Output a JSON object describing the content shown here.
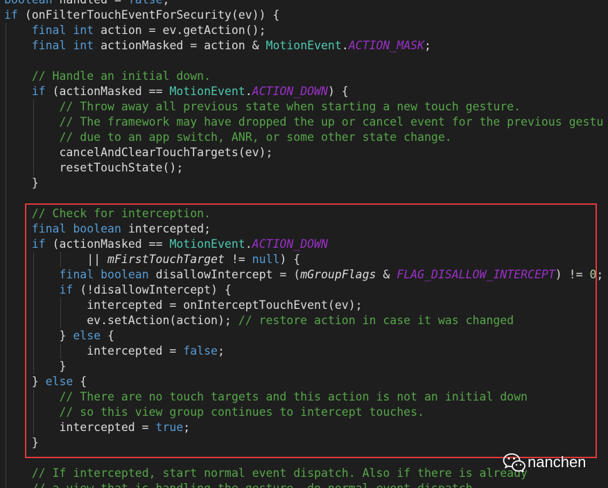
{
  "editor": {
    "colors": {
      "background": "#1e1e1e",
      "text": "#dcdcdc",
      "keyword": "#569cd6",
      "comment": "#57a64a",
      "type": "#4ec9b0",
      "constant": "#9b30c9",
      "field": "#dcdcdc",
      "number": "#b5cea8",
      "indent_guide": "#404040"
    },
    "lines": [
      [
        {
          "keyword": "boolean"
        },
        {
          "plain": " handled = "
        },
        {
          "keyword": "false"
        },
        {
          "plain": ";"
        }
      ],
      [
        {
          "keyword": "if"
        },
        {
          "plain": " (onFilterTouchEventForSecurity(ev)) {"
        }
      ],
      [
        {
          "plain": "    "
        },
        {
          "keyword": "final"
        },
        {
          "plain": " "
        },
        {
          "keyword": "int"
        },
        {
          "plain": " action = ev.getAction();"
        }
      ],
      [
        {
          "plain": "    "
        },
        {
          "keyword": "final"
        },
        {
          "plain": " "
        },
        {
          "keyword": "int"
        },
        {
          "plain": " actionMasked = action & "
        },
        {
          "type": "MotionEvent"
        },
        {
          "plain": "."
        },
        {
          "constant": "ACTION_MASK"
        },
        {
          "plain": ";"
        }
      ],
      [],
      [
        {
          "plain": "    "
        },
        {
          "comment": "// Handle an initial down."
        }
      ],
      [
        {
          "plain": "    "
        },
        {
          "keyword": "if"
        },
        {
          "plain": " (actionMasked == "
        },
        {
          "type": "MotionEvent"
        },
        {
          "plain": "."
        },
        {
          "constant": "ACTION_DOWN"
        },
        {
          "plain": ") {"
        }
      ],
      [
        {
          "plain": "        "
        },
        {
          "comment": "// Throw away all previous state when starting a new touch gesture."
        }
      ],
      [
        {
          "plain": "        "
        },
        {
          "comment": "// The framework may have dropped the up or cancel event for the previous gestu"
        }
      ],
      [
        {
          "plain": "        "
        },
        {
          "comment": "// due to an app switch, ANR, or some other state change."
        }
      ],
      [
        {
          "plain": "        cancelAndClearTouchTargets(ev);"
        }
      ],
      [
        {
          "plain": "        resetTouchState();"
        }
      ],
      [
        {
          "plain": "    }"
        }
      ],
      [],
      [
        {
          "plain": "    "
        },
        {
          "comment": "// Check for interception."
        }
      ],
      [
        {
          "plain": "    "
        },
        {
          "keyword": "final"
        },
        {
          "plain": " "
        },
        {
          "keyword": "boolean"
        },
        {
          "plain": " intercepted;"
        }
      ],
      [
        {
          "plain": "    "
        },
        {
          "keyword": "if"
        },
        {
          "plain": " (actionMasked == "
        },
        {
          "type": "MotionEvent"
        },
        {
          "plain": "."
        },
        {
          "constant": "ACTION_DOWN"
        }
      ],
      [
        {
          "plain": "            || "
        },
        {
          "field": "mFirstTouchTarget"
        },
        {
          "plain": " != "
        },
        {
          "keyword": "null"
        },
        {
          "plain": ") {"
        }
      ],
      [
        {
          "plain": "        "
        },
        {
          "keyword": "final"
        },
        {
          "plain": " "
        },
        {
          "keyword": "boolean"
        },
        {
          "plain": " disallowIntercept = ("
        },
        {
          "field": "mGroupFlags"
        },
        {
          "plain": " & "
        },
        {
          "constant": "FLAG_DISALLOW_INTERCEPT"
        },
        {
          "plain": ") != "
        },
        {
          "number": "0"
        },
        {
          "plain": ";"
        }
      ],
      [
        {
          "plain": "        "
        },
        {
          "keyword": "if"
        },
        {
          "plain": " (!disallowIntercept) {"
        }
      ],
      [
        {
          "plain": "            intercepted = onInterceptTouchEvent(ev);"
        }
      ],
      [
        {
          "plain": "            ev.setAction(action); "
        },
        {
          "comment": "// restore action in case it was changed"
        }
      ],
      [
        {
          "plain": "        } "
        },
        {
          "keyword": "else"
        },
        {
          "plain": " {"
        }
      ],
      [
        {
          "plain": "            intercepted = "
        },
        {
          "keyword": "false"
        },
        {
          "plain": ";"
        }
      ],
      [
        {
          "plain": "        }"
        }
      ],
      [
        {
          "plain": "    } "
        },
        {
          "keyword": "else"
        },
        {
          "plain": " {"
        }
      ],
      [
        {
          "plain": "        "
        },
        {
          "comment": "// There are no touch targets and this action is not an initial down"
        }
      ],
      [
        {
          "plain": "        "
        },
        {
          "comment": "// so this view group continues to intercept touches."
        }
      ],
      [
        {
          "plain": "        intercepted = "
        },
        {
          "keyword": "true"
        },
        {
          "plain": ";"
        }
      ],
      [
        {
          "plain": "    }"
        }
      ],
      [],
      [
        {
          "plain": "    "
        },
        {
          "comment": "// If intercepted, start normal event dispatch. Also if there is already"
        }
      ],
      [
        {
          "plain": "    "
        },
        {
          "comment": "// a view that is handling the gesture, do normal event dispatch."
        }
      ]
    ]
  },
  "highlight": {
    "color": "#e03a3a"
  },
  "watermark": {
    "icon": "wechat-icon",
    "text": "nanchen",
    "color": "#ffffff"
  }
}
